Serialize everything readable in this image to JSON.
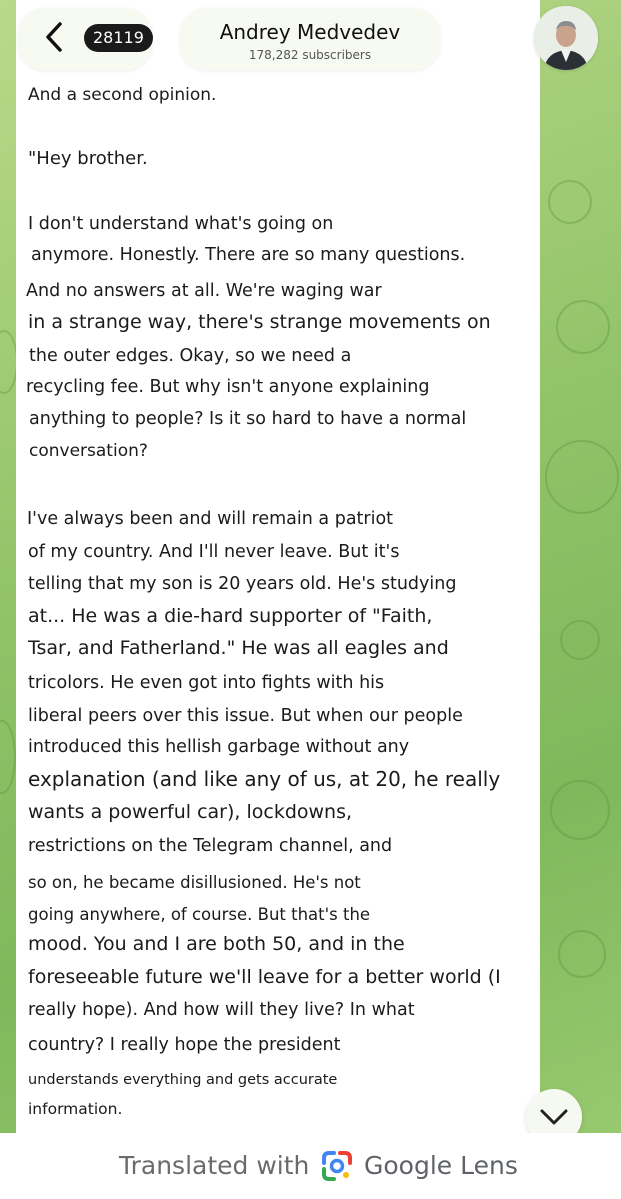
{
  "header": {
    "back_badge": "28119",
    "channel_name": "Andrey Medvedev",
    "subscribers": "178,282 subscribers"
  },
  "message": {
    "lines": [
      "And a second opinion.",
      "\"Hey brother.",
      "I don't understand what's going on",
      "anymore. Honestly. There are so many questions.",
      "And no answers at all. We're waging war",
      "in a strange way, there's strange movements on",
      "the outer edges. Okay, so we need a",
      "recycling fee. But why isn't anyone explaining",
      "anything to people? Is it so hard to have a normal",
      "conversation?",
      "I've always been and will remain a patriot",
      "of my country. And I'll never leave. But it's",
      "telling that my son is 20 years old. He's studying",
      "at... He was a die-hard supporter of \"Faith,",
      "Tsar, and Fatherland.\" He was all eagles and",
      "tricolors. He even got into fights with his",
      "liberal peers over this issue. But when our people",
      "introduced this hellish garbage without any",
      "explanation (and like any of us, at 20, he really",
      "wants a powerful car), lockdowns,",
      "restrictions on the Telegram channel, and",
      "so on, he became disillusioned. He's not",
      "going anywhere, of course. But that's the",
      "mood. You and I are both 50, and in the",
      "foreseeable future we'll leave for a better world (I",
      "really hope). And how will they live? In what",
      "country? I really hope the president",
      "understands everything and gets accurate",
      "information."
    ]
  },
  "footer": {
    "prefix": "Translated with",
    "brand": "Google Lens"
  },
  "icons": {
    "back": "chevron-left-icon",
    "scroll_down": "chevron-down-icon",
    "lens": "google-lens-icon"
  }
}
